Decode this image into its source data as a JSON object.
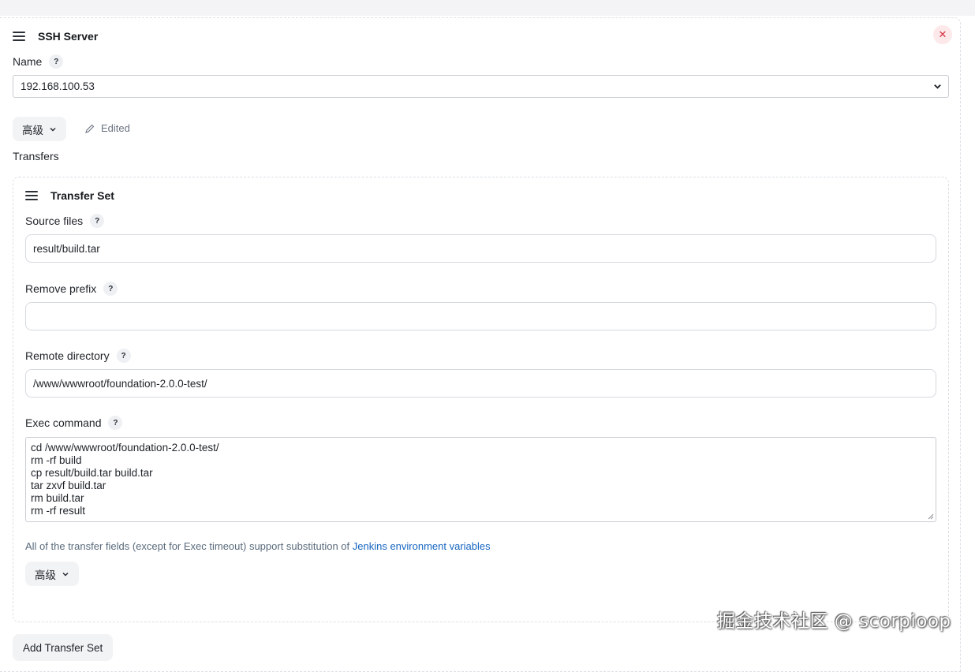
{
  "server": {
    "title": "SSH Server",
    "name_label": "Name",
    "name_value": "192.168.100.53",
    "advanced_label": "高级",
    "edited_label": "Edited"
  },
  "transfers": {
    "label": "Transfers",
    "set": {
      "title": "Transfer Set",
      "source_files": {
        "label": "Source files",
        "value": "result/build.tar"
      },
      "remove_prefix": {
        "label": "Remove prefix",
        "value": ""
      },
      "remote_directory": {
        "label": "Remote directory",
        "value": "/www/wwwroot/foundation-2.0.0-test/"
      },
      "exec_command": {
        "label": "Exec command",
        "lines": [
          "cd /www/wwwroot/foundation-2.0.0-test/",
          "rm -rf build",
          "cp result/build.tar build.tar",
          "tar zxvf build.tar",
          "rm build.tar",
          "rm -rf result"
        ]
      },
      "hint_text": "All of the transfer fields (except for Exec timeout) support substitution of ",
      "hint_link": "Jenkins environment variables",
      "advanced_label": "高级"
    },
    "add_button": "Add Transfer Set"
  },
  "help_glyph": "?",
  "close_glyph": "✕",
  "watermark": "掘金技术社区 @ scorpioop",
  "colors": {
    "close_bg": "#fde8ea",
    "close_fg": "#d6303f",
    "link": "#1565c0"
  }
}
